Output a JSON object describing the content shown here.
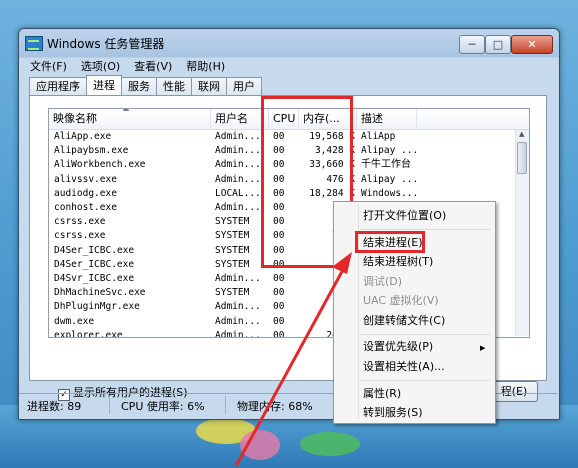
{
  "window": {
    "title": "Windows 任务管理器",
    "controls": {
      "minimize": "─",
      "maximize": "□",
      "close": "✕"
    }
  },
  "menubar": [
    "文件(F)",
    "选项(O)",
    "查看(V)",
    "帮助(H)"
  ],
  "tabs": [
    "应用程序",
    "进程",
    "服务",
    "性能",
    "联网",
    "用户"
  ],
  "active_tab": "进程",
  "columns": {
    "name": "映像名称",
    "user": "用户名",
    "cpu": "CPU",
    "mem": "内存(...",
    "desc": "描述"
  },
  "processes": [
    {
      "name": "AliApp.exe",
      "user": "Admin...",
      "cpu": "00",
      "mem": "19,568 K",
      "desc": "AliApp"
    },
    {
      "name": "Alipaybsm.exe",
      "user": "Admin...",
      "cpu": "00",
      "mem": "3,428 K",
      "desc": "Alipay ..."
    },
    {
      "name": "AliWorkbench.exe",
      "user": "Admin...",
      "cpu": "00",
      "mem": "33,660 K",
      "desc": "千牛工作台"
    },
    {
      "name": "alivssv.exe",
      "user": "Admin...",
      "cpu": "00",
      "mem": "476 K",
      "desc": "Alipay ..."
    },
    {
      "name": "audiodg.exe",
      "user": "LOCAL...",
      "cpu": "00",
      "mem": "18,284 K",
      "desc": "Windows..."
    },
    {
      "name": "conhost.exe",
      "user": "Admin...",
      "cpu": "00",
      "mem": "22",
      "desc": ""
    },
    {
      "name": "csrss.exe",
      "user": "SYSTEM",
      "cpu": "00",
      "mem": "64",
      "desc": ""
    },
    {
      "name": "csrss.exe",
      "user": "SYSTEM",
      "cpu": "00",
      "mem": "7,41",
      "desc": ""
    },
    {
      "name": "D4Ser_ICBC.exe",
      "user": "SYSTEM",
      "cpu": "00",
      "mem": "24",
      "desc": ""
    },
    {
      "name": "D4Ser_ICBC.exe",
      "user": "SYSTEM",
      "cpu": "00",
      "mem": "24",
      "desc": ""
    },
    {
      "name": "D4Svr_ICBC.exe",
      "user": "Admin...",
      "cpu": "00",
      "mem": "56",
      "desc": ""
    },
    {
      "name": "DhMachineSvc.exe",
      "user": "SYSTEM",
      "cpu": "00",
      "mem": "73",
      "desc": ""
    },
    {
      "name": "DhPluginMgr.exe",
      "user": "Admin...",
      "cpu": "00",
      "mem": "64",
      "desc": ""
    },
    {
      "name": "dwm.exe",
      "user": "Admin...",
      "cpu": "00",
      "mem": "1,63",
      "desc": ""
    },
    {
      "name": "explorer.exe",
      "user": "Admin...",
      "cpu": "00",
      "mem": "26,62",
      "desc": ""
    }
  ],
  "show_all_label": "显示所有用户的进程(S)",
  "show_all_checked": true,
  "end_button_label": "程(E)",
  "status": {
    "processes": "进程数: 89",
    "cpu": "CPU 使用率: 6%",
    "memory": "物理内存: 68%"
  },
  "context_menu": {
    "open_location": "打开文件位置(O)",
    "end_process": "结束进程(E)",
    "end_tree": "结束进程树(T)",
    "debug": "调试(D)",
    "uac": "UAC 虚拟化(V)",
    "dump": "创建转储文件(C)",
    "priority": "设置优先级(P)",
    "affinity": "设置相关性(A)...",
    "properties": "属性(R)",
    "goto_service": "转到服务(S)"
  },
  "colors": {
    "annotation": "#e3282a",
    "desktop": "#4d9bd0",
    "window_frame": "#c7d9ec"
  }
}
